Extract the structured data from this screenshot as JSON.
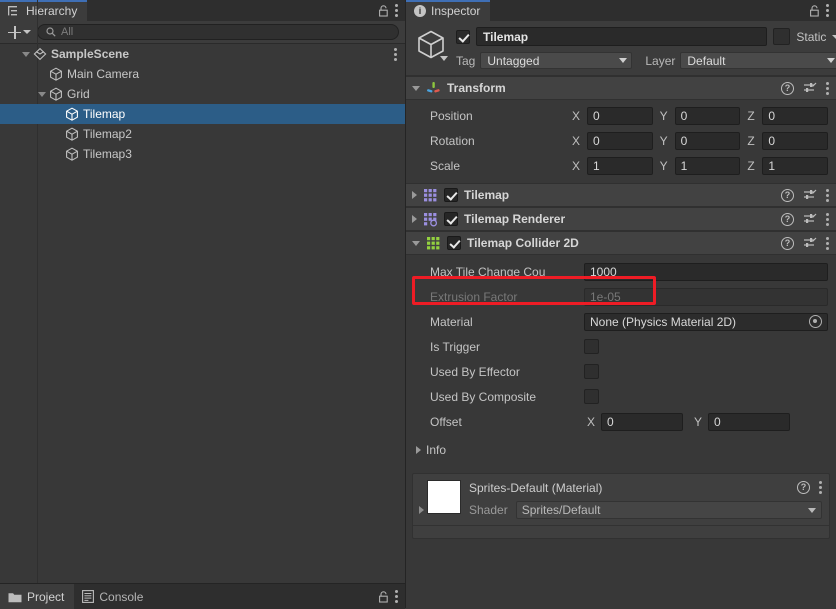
{
  "hierarchy": {
    "tab_label": "Hierarchy",
    "tab_icon": "hierarchy-icon",
    "lock_icon": "lock-icon",
    "menu_icon": "kebab-menu-icon",
    "toolbar": {
      "add_label": "+",
      "add_icon": "plus-icon",
      "dropdown_icon": "chevron-down-icon",
      "search_icon": "search-icon",
      "search_placeholder": "All",
      "search_value": ""
    },
    "rows": [
      {
        "label": "SampleScene",
        "icon": "scene-icon",
        "indent": 0,
        "foldout": "open",
        "selected": false,
        "has_menu": true
      },
      {
        "label": "Main Camera",
        "icon": "gameobject-cube-icon",
        "indent": 1,
        "foldout": "none",
        "selected": false,
        "has_menu": false
      },
      {
        "label": "Grid",
        "icon": "gameobject-cube-icon",
        "indent": 1,
        "foldout": "open",
        "selected": false,
        "has_menu": false
      },
      {
        "label": "Tilemap",
        "icon": "gameobject-cube-icon",
        "indent": 2,
        "foldout": "none",
        "selected": true,
        "has_menu": false
      },
      {
        "label": "Tilemap2",
        "icon": "gameobject-cube-icon",
        "indent": 2,
        "foldout": "none",
        "selected": false,
        "has_menu": false
      },
      {
        "label": "Tilemap3",
        "icon": "gameobject-cube-icon",
        "indent": 2,
        "foldout": "none",
        "selected": false,
        "has_menu": false
      }
    ]
  },
  "bottom_tabs": {
    "project_label": "Project",
    "project_icon": "folder-icon",
    "console_label": "Console",
    "console_icon": "console-icon",
    "lock_icon": "lock-icon",
    "menu_icon": "kebab-menu-icon"
  },
  "inspector": {
    "tab_label": "Inspector",
    "tab_icon": "info-icon",
    "lock_icon": "lock-icon",
    "menu_icon": "kebab-menu-icon",
    "object_header": {
      "icon": "gameobject-cube-icon",
      "enabled": true,
      "name": "Tilemap",
      "static_label": "Static",
      "static_checked": false,
      "tag_label": "Tag",
      "tag_value": "Untagged",
      "layer_label": "Layer",
      "layer_value": "Default"
    },
    "transform": {
      "title": "Transform",
      "icon": "transform-axis-icon",
      "foldout": "open",
      "help_icon": "help-icon",
      "preset_icon": "preset-icon",
      "menu_icon": "kebab-menu-icon",
      "rows": [
        {
          "label": "Position",
          "x": "0",
          "y": "0",
          "z": "0"
        },
        {
          "label": "Rotation",
          "x": "0",
          "y": "0",
          "z": "0"
        },
        {
          "label": "Scale",
          "x": "1",
          "y": "1",
          "z": "1"
        }
      ],
      "axis_x": "X",
      "axis_y": "Y",
      "axis_z": "Z"
    },
    "components": [
      {
        "title": "Tilemap",
        "icon": "tilemap-grid-icon",
        "icon_color": "#9b8fe0",
        "foldout": "collapsed",
        "enabled": true,
        "highlighted": false
      },
      {
        "title": "Tilemap Renderer",
        "icon": "tilemap-renderer-icon",
        "icon_color": "#9b8fe0",
        "foldout": "collapsed",
        "enabled": true,
        "highlighted": false
      },
      {
        "title": "Tilemap Collider 2D",
        "icon": "tilemap-collider-icon",
        "icon_color": "#93d13f",
        "foldout": "open",
        "enabled": true,
        "highlighted": true
      }
    ],
    "collider_properties": {
      "max_tile_change_count": {
        "label": "Max Tile Change Cou",
        "value": "1000",
        "disabled": false
      },
      "extrusion_factor": {
        "label": "Extrusion Factor",
        "value": "1e-05",
        "disabled": true
      },
      "material": {
        "label": "Material",
        "value": "None (Physics Material 2D)",
        "picker_icon": "object-picker-icon"
      },
      "is_trigger": {
        "label": "Is Trigger",
        "checked": false
      },
      "used_by_effector": {
        "label": "Used By Effector",
        "checked": false
      },
      "used_by_composite": {
        "label": "Used By Composite",
        "checked": false
      },
      "offset": {
        "label": "Offset",
        "axis_x": "X",
        "x": "0",
        "axis_y": "Y",
        "y": "0"
      },
      "info": {
        "label": "Info",
        "foldout": "collapsed"
      }
    },
    "material_preview": {
      "title": "Sprites-Default (Material)",
      "swatch_color": "#ffffff",
      "shader_label": "Shader",
      "shader_value": "Sprites/Default",
      "help_icon": "help-icon",
      "menu_icon": "kebab-menu-icon",
      "foldout": "collapsed"
    }
  },
  "theme": {
    "panel_bg": "#383838",
    "header_bg": "#3c3c3c",
    "component_header_bg": "#424242",
    "selection_blue": "#2c5d87",
    "highlight_red": "#ee1c25",
    "field_bg": "#2a2a2a",
    "text": "#c4c4c4"
  }
}
